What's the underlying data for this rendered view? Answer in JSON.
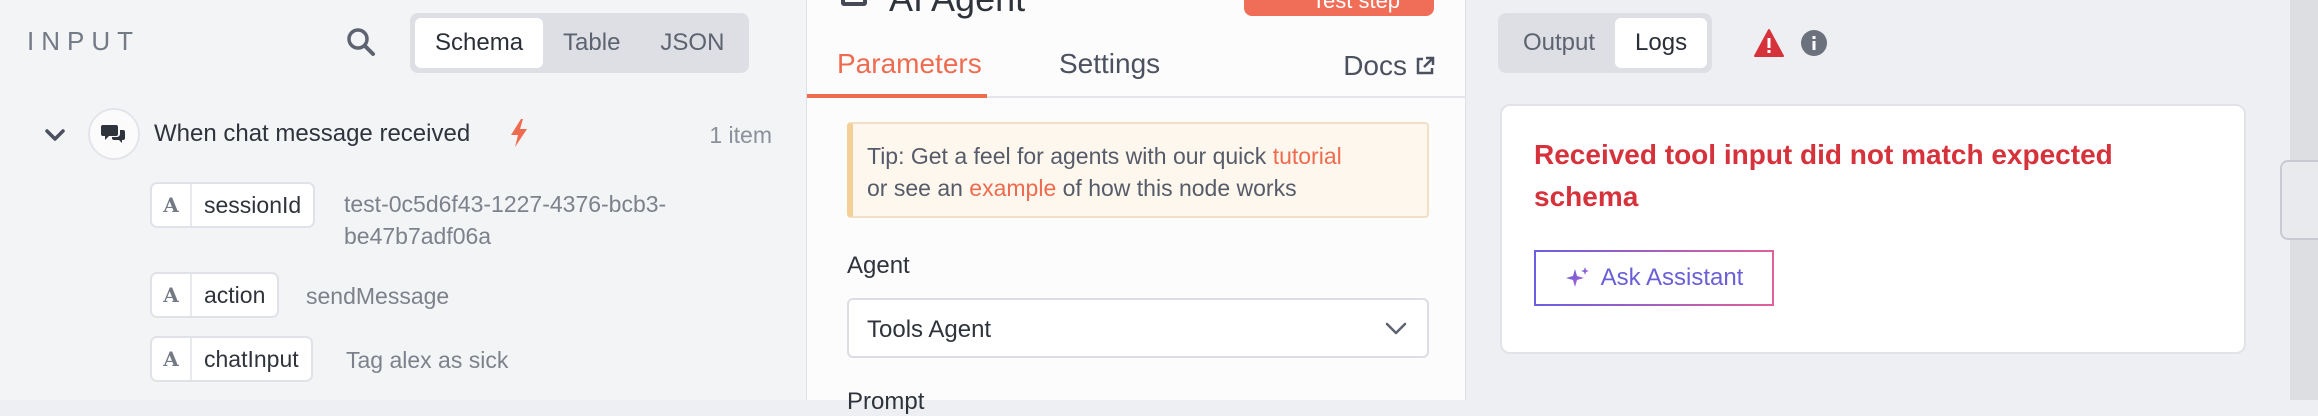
{
  "input": {
    "title": "INPUT",
    "view_tabs": [
      "Schema",
      "Table",
      "JSON"
    ],
    "active_view": "Schema",
    "trigger": {
      "label": "When chat message received",
      "item_count": "1 item"
    },
    "fields": [
      {
        "type": "A",
        "name": "sessionId",
        "value_line1": "test-0c5d6f43-1227-4376-bcb3-",
        "value_line2": "be47b7adf06a"
      },
      {
        "type": "A",
        "name": "action",
        "value_line1": "sendMessage"
      },
      {
        "type": "A",
        "name": "chatInput",
        "value_line1": "Tag alex as sick"
      }
    ]
  },
  "node": {
    "name": "AI Agent",
    "test_button": "Test step",
    "tabs": {
      "parameters": "Parameters",
      "settings": "Settings",
      "docs": "Docs"
    },
    "tip": {
      "prefix": "Tip: Get a feel for agents with our quick ",
      "tutorial_link": "tutorial",
      "middle": "or see an ",
      "example_link": "example",
      "suffix": " of how this node works"
    },
    "agent_label": "Agent",
    "agent_value": "Tools Agent",
    "prompt_label": "Prompt"
  },
  "output": {
    "tabs": [
      "Output",
      "Logs"
    ],
    "active_tab": "Logs",
    "error_message": "Received tool input did not match expected schema",
    "ask_button": "Ask Assistant"
  },
  "colors": {
    "accent": "#ee6b4f",
    "error": "#d6323b",
    "assistant": "#6a5fd6"
  },
  "icons": [
    "search-icon",
    "chevron-down-icon",
    "chat-icon",
    "bolt-icon",
    "external-link-icon",
    "warning-icon",
    "info-icon",
    "sparkle-icon"
  ]
}
